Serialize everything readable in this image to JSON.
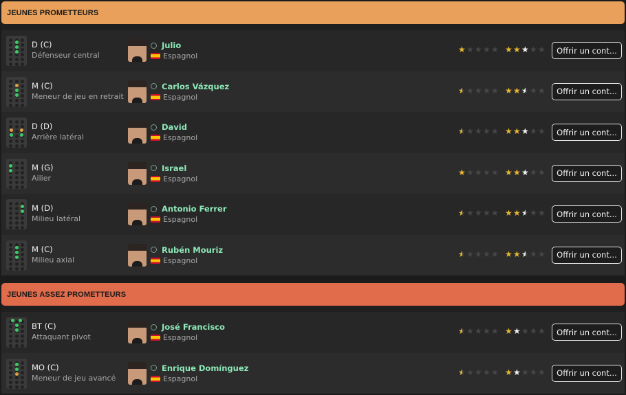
{
  "colors": {
    "header1": "#e8a05a",
    "header2": "#e06c4c"
  },
  "sections": [
    {
      "title": "JEUNES PROMETTEURS",
      "players": [
        {
          "role": "D (C)",
          "desc": "Défenseur central",
          "name": "Julio",
          "nationality": "Espagnol",
          "current_stars": 1,
          "potential_stars": 3,
          "button": "Offrir un cont..."
        },
        {
          "role": "M (C)",
          "desc": "Meneur de jeu en retrait",
          "name": "Carlos Vázquez",
          "nationality": "Espagnol",
          "current_stars": 0.5,
          "potential_stars": 2.5,
          "button": "Offrir un cont..."
        },
        {
          "role": "D (D)",
          "desc": "Arrière latéral",
          "name": "David",
          "nationality": "Espagnol",
          "current_stars": 0.5,
          "potential_stars": 3,
          "button": "Offrir un cont..."
        },
        {
          "role": "M (G)",
          "desc": "Ailier",
          "name": "Israel",
          "nationality": "Espagnol",
          "current_stars": 1,
          "potential_stars": 3,
          "button": "Offrir un cont..."
        },
        {
          "role": "M (D)",
          "desc": "Milieu latéral",
          "name": "Antonio Ferrer",
          "nationality": "Espagnol",
          "current_stars": 0.5,
          "potential_stars": 2.5,
          "button": "Offrir un cont..."
        },
        {
          "role": "M (C)",
          "desc": "Milieu axial",
          "name": "Rubén Mouriz",
          "nationality": "Espagnol",
          "current_stars": 0.5,
          "potential_stars": 2.5,
          "button": "Offrir un cont..."
        }
      ]
    },
    {
      "title": "JEUNES ASSEZ PROMETTEURS",
      "players": [
        {
          "role": "BT (C)",
          "desc": "Attaquant pivot",
          "name": "José Francisco",
          "nationality": "Espagnol",
          "current_stars": 0.5,
          "potential_stars": 2,
          "button": "Offrir un cont..."
        },
        {
          "role": "MO (C)",
          "desc": "Meneur de jeu avancé",
          "name": "Enrique Domínguez",
          "nationality": "Espagnol",
          "current_stars": 0.5,
          "potential_stars": 2,
          "button": "Offrir un cont..."
        }
      ]
    }
  ]
}
